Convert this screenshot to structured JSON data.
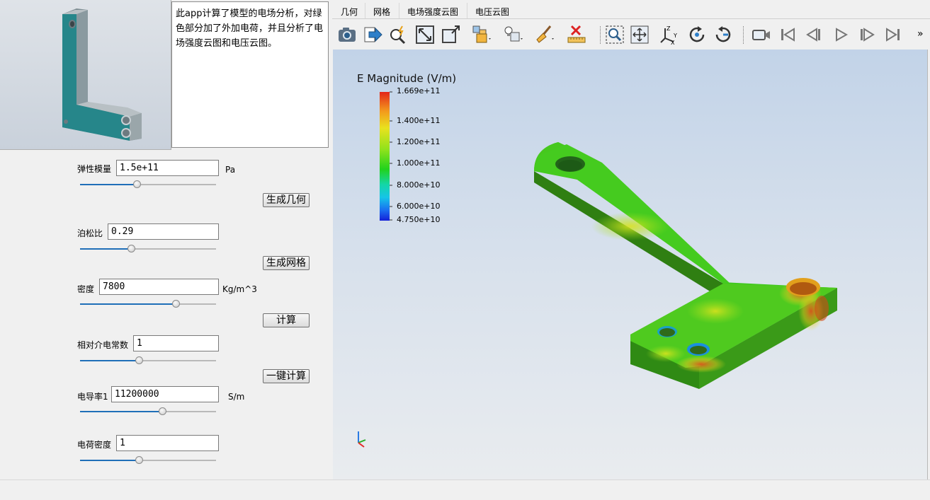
{
  "description": "此app计算了模型的电场分析，对绿色部分加了外加电荷，并且分析了电场强度云图和电压云图。",
  "params": [
    {
      "label": "弹性模量",
      "value": "1.5e+11",
      "unit": "Pa",
      "slider": 0.42
    },
    {
      "label": "泊松比",
      "value": "0.29",
      "unit": "",
      "slider": 0.38
    },
    {
      "label": "密度",
      "value": "7800",
      "unit": "Kg/m^3",
      "slider": 0.71
    },
    {
      "label": "相对介电常数",
      "value": "1",
      "unit": "",
      "slider": 0.44
    },
    {
      "label": "电导率1",
      "value": "11200000",
      "unit": "S/m",
      "slider": 0.61
    },
    {
      "label": "电荷密度",
      "value": "1",
      "unit": "",
      "slider": 0.44
    }
  ],
  "buttons": {
    "gen_geometry": "生成几何",
    "gen_mesh": "生成网格",
    "compute": "计算",
    "one_click": "一键计算"
  },
  "tabs": [
    "几何",
    "网格",
    "电场强度云图",
    "电压云图"
  ],
  "toolbar": {
    "icons": [
      "camera-icon",
      "export-icon",
      "zoom-lightning-icon",
      "fit-view-icon",
      "box-expand-icon",
      "cube-stack-icon",
      "light-cube-icon",
      "broom-icon",
      "ruler-delete-icon",
      "zoom-box-icon",
      "pan-icon",
      "axes-icon",
      "rotate-cw-icon",
      "rotate-ccw-icon",
      "video-camera-icon",
      "first-frame-icon",
      "prev-frame-icon",
      "play-icon",
      "next-frame-icon",
      "last-frame-icon"
    ],
    "more": "»"
  },
  "legend": {
    "title": "E Magnitude (V/m)",
    "ticks": [
      "1.669e+11",
      "1.400e+11",
      "1.200e+11",
      "1.000e+11",
      "8.000e+10",
      "6.000e+10",
      "4.750e+10"
    ]
  },
  "colors": {
    "accent": "#1f6fb8",
    "model_green": "#3fc81e",
    "plate_teal": "#2a8c8c"
  }
}
